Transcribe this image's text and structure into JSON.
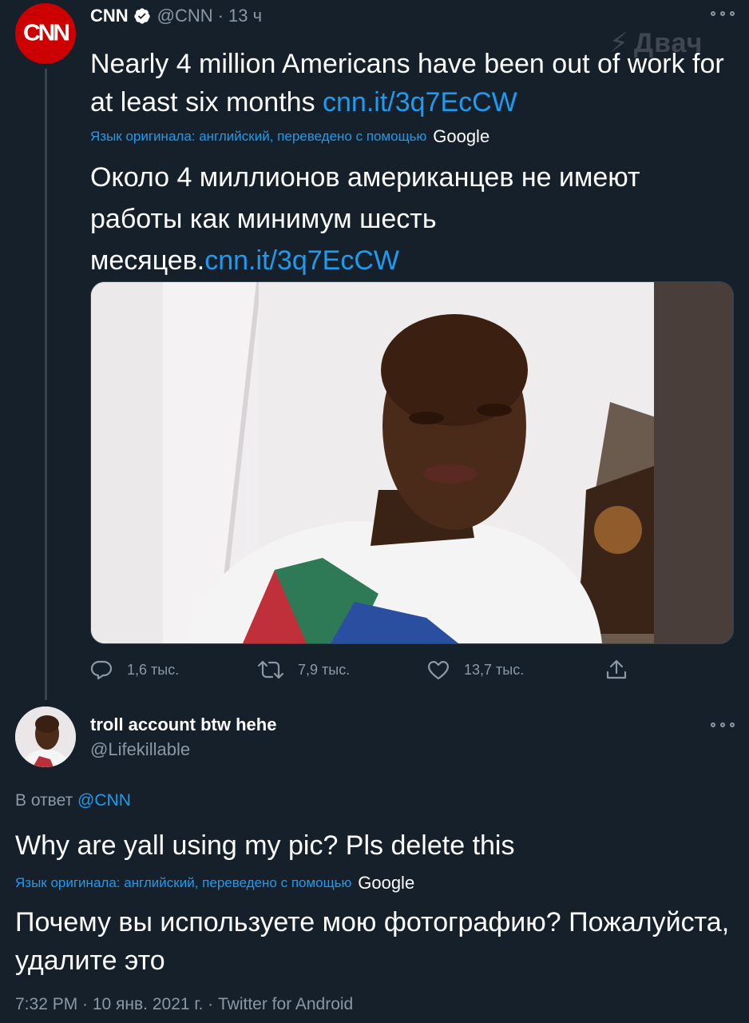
{
  "cnn_tweet": {
    "avatar_text": "CNN",
    "display_name": "CNN",
    "handle": "@CNN",
    "separator": "·",
    "time": "13 ч",
    "watermark": "Двач",
    "text": "Nearly 4 million Americans have been out of work for at least six months",
    "link": "cnn.it/3q7EcCW",
    "translated_label": "Язык оригинала: английский, переведено с помощью",
    "translator": "Google",
    "translation_text": "Около 4 миллионов американцев не имеют работы как минимум шесть месяцев.",
    "translation_link": "cnn.it/3q7EcCW",
    "actions": {
      "replies": "1,6 тыс.",
      "retweets": "7,9 тыс.",
      "likes": "13,7 тыс."
    }
  },
  "reply_tweet": {
    "display_name": "troll account btw hehe",
    "handle": "@Lifekillable",
    "reply_to_label": "В ответ",
    "reply_to_handle": "@CNN",
    "text": "Why are yall using my pic? Pls delete this",
    "translated_label": "Язык оригинала: английский, переведено с помощью",
    "translator": "Google",
    "translation_text": "Почему вы используете мою фотографию? Пожалуйста, удалите это",
    "footer": "7:32 PM · 10 янв. 2021 г. · Twitter for Android"
  },
  "colors": {
    "background": "#15202b",
    "link_blue": "#1d9bf0",
    "secondary_text": "#8b98a5",
    "cnn_red": "#cc0000"
  }
}
